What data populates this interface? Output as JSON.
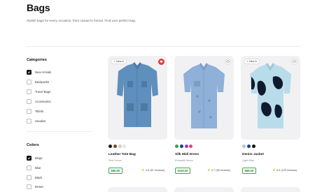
{
  "header": {
    "title": "Bags",
    "subtitle": "Stylish bags for every occasion, from casual to formal. Find your perfect bag."
  },
  "filters": {
    "categories": {
      "title": "Categories",
      "items": [
        {
          "label": "New Arrivals",
          "checked": true
        },
        {
          "label": "Backpacks",
          "checked": false
        },
        {
          "label": "Travel Bags",
          "checked": false
        },
        {
          "label": "Accessories",
          "checked": false
        },
        {
          "label": "Tshirts",
          "checked": false
        },
        {
          "label": "Hoodies",
          "checked": false
        }
      ]
    },
    "colors": {
      "title": "Colors",
      "items": [
        {
          "label": "Beige",
          "checked": true
        },
        {
          "label": "Blue",
          "checked": false
        },
        {
          "label": "Black",
          "checked": false
        },
        {
          "label": "Brown",
          "checked": false
        }
      ]
    }
  },
  "products": [
    {
      "name": "Leather Tote Bag",
      "color": "Pink Yonce",
      "price": "$65.00",
      "rating": "4.6 (87 reviews)",
      "badge": "New In",
      "favorite": true,
      "swatches": [
        "#1b1b1b",
        "#7a4a2c",
        "#d8cdb9",
        "#e4e4e4"
      ],
      "shirt_color": "#5f8fbd",
      "shirt_shade": "#4d7aa5"
    },
    {
      "name": "Silk Midi Dress",
      "color": "Emerald Green",
      "price": "$100.00",
      "rating": "4.7 (95 reviews)",
      "badge": "",
      "favorite": false,
      "swatches": [
        "#2fa84f",
        "#1d3c8c",
        "#8a47c9",
        "#e53f7a"
      ],
      "shirt_color": "#8fb0d8",
      "shirt_shade": "#7a9cc6"
    },
    {
      "name": "Denim Jacket",
      "color": "Light Blue",
      "price": "$89.00",
      "rating": "4.3 (120 reviews)",
      "badge": "New In",
      "favorite": false,
      "swatches": [
        "#a9c6ea",
        "#1d3c8c",
        "#111111"
      ],
      "shirt_color": "#b9dcea",
      "shirt_shade": "#0f1a2e"
    }
  ]
}
